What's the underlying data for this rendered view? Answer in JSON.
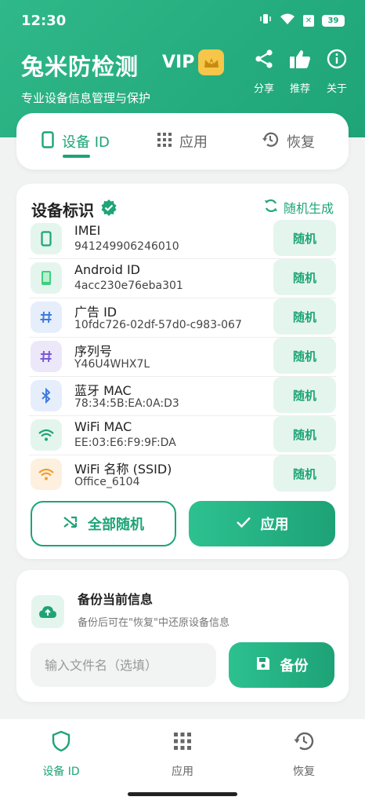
{
  "status": {
    "time": "12:30",
    "battery": "39"
  },
  "header": {
    "title": "兔米防检测",
    "vip": "VIP",
    "subtitle": "专业设备信息管理与保护",
    "actions": [
      {
        "label": "分享",
        "icon": "share-icon"
      },
      {
        "label": "推荐",
        "icon": "thumbs-up-icon"
      },
      {
        "label": "关于",
        "icon": "info-icon"
      }
    ]
  },
  "tabs": [
    {
      "label": "设备 ID",
      "icon": "phone-icon",
      "active": true
    },
    {
      "label": "应用",
      "icon": "grid-icon",
      "active": false
    },
    {
      "label": "恢复",
      "icon": "history-icon",
      "active": false
    }
  ],
  "device_card": {
    "title": "设备标识",
    "generate_label": "随机生成",
    "rows": [
      {
        "label": "IMEI",
        "value": "941249906246010",
        "icon": "phone-icon",
        "random_label": "随机"
      },
      {
        "label": "Android ID",
        "value": "4acc230e76eba301",
        "icon": "android-phone-icon",
        "random_label": "随机"
      },
      {
        "label": "广告 ID",
        "value": "10fdc726-02df-57d0-c983-067",
        "icon": "hash-icon",
        "random_label": "随机"
      },
      {
        "label": "序列号",
        "value": "Y46U4WHX7L",
        "icon": "hash-icon",
        "random_label": "随机"
      },
      {
        "label": "蓝牙 MAC",
        "value": "78:34:5B:EA:0A:D3",
        "icon": "bluetooth-icon",
        "random_label": "随机"
      },
      {
        "label": "WiFi MAC",
        "value": "EE:03:E6:F9:9F:DA",
        "icon": "wifi-icon",
        "random_label": "随机"
      },
      {
        "label": "WiFi 名称 (SSID)",
        "value": "Office_6104",
        "icon": "wifi-icon",
        "random_label": "随机"
      }
    ],
    "randomize_all_label": "全部随机",
    "apply_label": "应用"
  },
  "backup": {
    "title": "备份当前信息",
    "description": "备份后可在\"恢复\"中还原设备信息",
    "input_placeholder": "输入文件名（选填）",
    "button_label": "备份"
  },
  "bottom_nav": [
    {
      "label": "设备 ID",
      "icon": "shield-icon",
      "active": true
    },
    {
      "label": "应用",
      "icon": "grid-icon",
      "active": false
    },
    {
      "label": "恢复",
      "icon": "history-icon",
      "active": false
    }
  ],
  "colors": {
    "primary": "#1ea477",
    "light": "#e4f5ee",
    "vip_badge": "#f6c64a"
  }
}
